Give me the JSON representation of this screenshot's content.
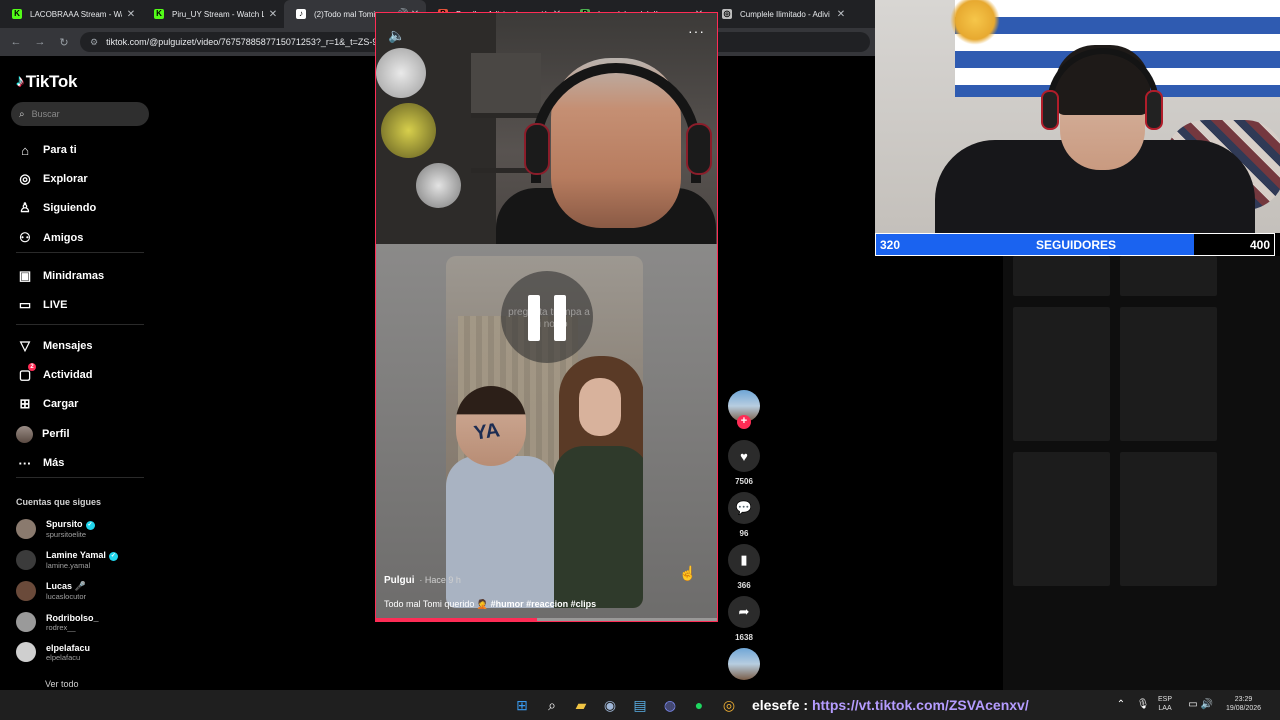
{
  "browser": {
    "tabs": [
      {
        "title": "LACOBRAAA Stream - Wat",
        "favicon": "K",
        "favicon_color": "#53fc18",
        "active": false
      },
      {
        "title": "Piru_UY Stream - Watch Li",
        "favicon": "K",
        "favicon_color": "#53fc18",
        "active": false
      },
      {
        "title": "(2)Todo mal Tomi quer",
        "favicon": "♪",
        "favicon_color": "#ffffff",
        "active": true
      },
      {
        "title": "Bandle - Adivina la canció",
        "favicon": "B",
        "favicon_color": "#e5533b",
        "active": false
      },
      {
        "title": "La palabra del día",
        "favicon": "P",
        "favicon_color": "#4caf50",
        "active": false
      },
      {
        "title": "Cumplele Ilimitado - Adivi",
        "favicon": "◎",
        "favicon_color": "#bdbdbd",
        "active": false
      }
    ],
    "url": "tiktok.com/@pulguizet/video/7675788587715071253?_r=1&_t=ZS-991rXc3ucCH"
  },
  "tiktok": {
    "logo": "TikTok",
    "search_placeholder": "Buscar",
    "nav": [
      {
        "label": "Para ti",
        "icon": "home-icon"
      },
      {
        "label": "Explorar",
        "icon": "compass-icon"
      },
      {
        "label": "Siguiendo",
        "icon": "following-icon"
      },
      {
        "label": "Amigos",
        "icon": "friends-icon"
      },
      {
        "label": "Minidramas",
        "icon": "minidramas-icon"
      },
      {
        "label": "LIVE",
        "icon": "live-icon"
      },
      {
        "label": "Mensajes",
        "icon": "messages-icon"
      },
      {
        "label": "Actividad",
        "icon": "activity-icon",
        "badge": "2"
      },
      {
        "label": "Cargar",
        "icon": "upload-icon"
      },
      {
        "label": "Perfil",
        "icon": "profile-avatar"
      },
      {
        "label": "Más",
        "icon": "more-icon"
      }
    ],
    "following_header": "Cuentas que sigues",
    "following": [
      {
        "name": "Spursito",
        "handle": "spursitoelite",
        "verified": true
      },
      {
        "name": "Lamine Yamal",
        "handle": "lamine.yamal",
        "verified": true
      },
      {
        "name": "Lucas 🎤",
        "handle": "lucaslocutor",
        "verified": false
      },
      {
        "name": "Rodribolso_",
        "handle": "rodrex__",
        "verified": false
      },
      {
        "name": "elpelafacu",
        "handle": "elpelafacu",
        "verified": false
      }
    ],
    "see_all": "Ver todo",
    "video": {
      "author": "Pulgui",
      "time": "· Hace 9 h",
      "caption_text": "Todo mal Tomi querido 🤦 ",
      "caption_tags": "#humor #reaccion #clips",
      "overlay_text": "pregunta trampa a mi novio",
      "shirt_text": "YA",
      "progress": 0.47
    },
    "actions": {
      "likes": "7506",
      "comments": "96",
      "saves": "366",
      "shares": "1638"
    }
  },
  "stream_overlay": {
    "followers_current": "320",
    "followers_label": "SEGUIDORES",
    "followers_goal": "400",
    "followers_fraction": 0.8
  },
  "taskbar": {
    "chat_nick": "elesefe",
    "chat_sep": " : ",
    "chat_message": "https://vt.tiktok.com/ZSVAcenxv/",
    "lang_top": "ESP",
    "lang_bottom": "LAA",
    "time": "23:29",
    "date": "19/08/2026"
  }
}
